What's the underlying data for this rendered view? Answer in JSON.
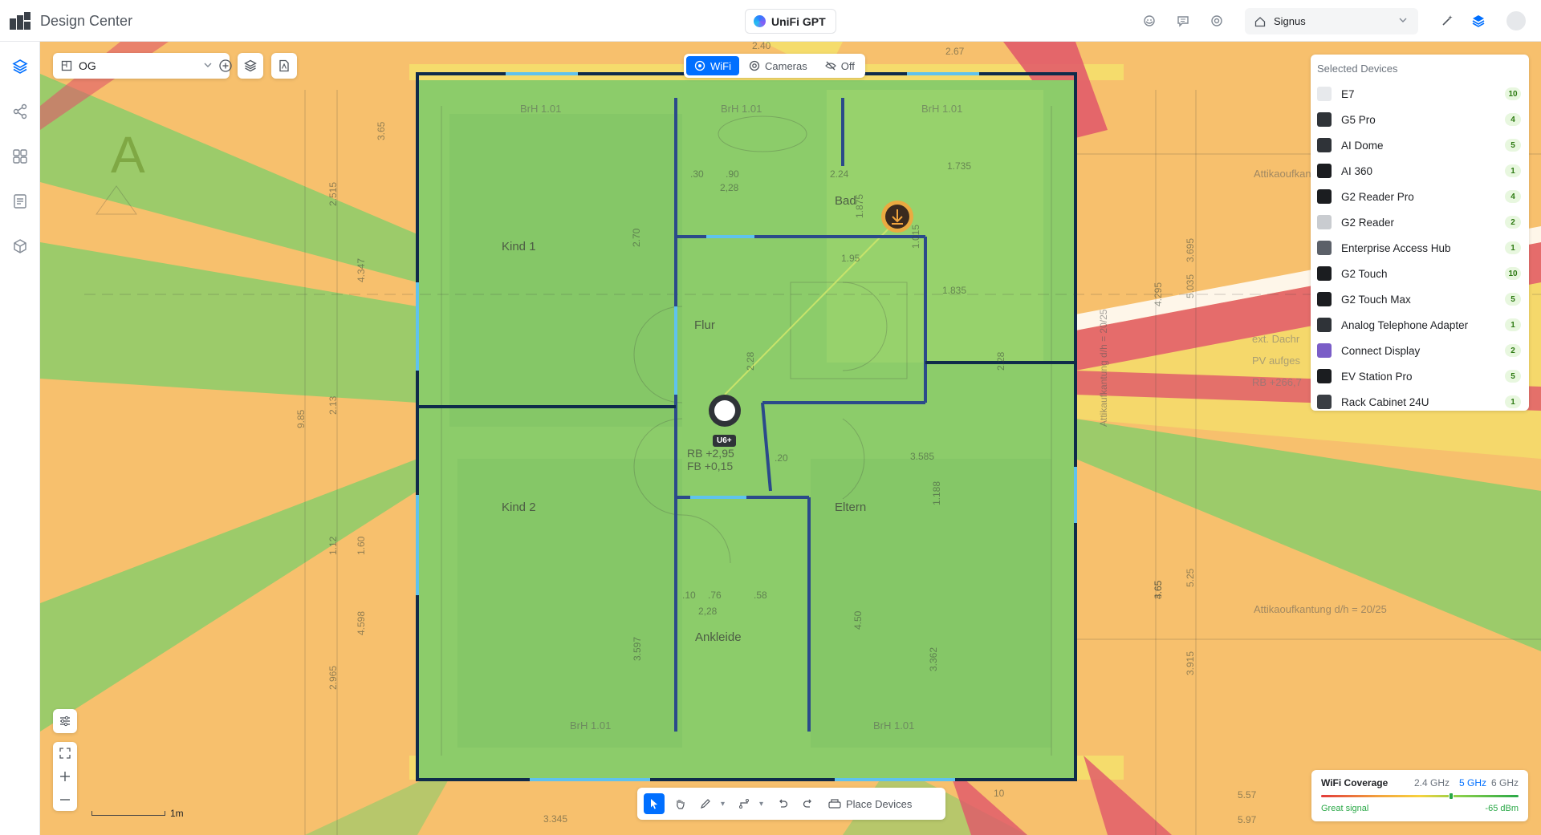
{
  "header": {
    "app_title": "Design Center",
    "gpt_label": "UniFi GPT",
    "site_name": "Signus"
  },
  "canvas": {
    "floor": "OG",
    "modes": [
      {
        "label": "WiFi",
        "icon": "wifi-icon",
        "active": true
      },
      {
        "label": "Cameras",
        "icon": "camera-icon",
        "active": false
      },
      {
        "label": "Off",
        "icon": "eye-off-icon",
        "active": false
      }
    ],
    "rooms": [
      "Kind 1",
      "Kind 2",
      "Flur",
      "Bad",
      "Eltern",
      "Ankleide"
    ],
    "ap_label": "U6+",
    "section_letter": "A",
    "scale_label": "1m",
    "plan_text": {
      "brh1": "BrH 1.01",
      "rb": "RB +2,95",
      "fb": "FB +0,15",
      "attika1": "Attikaoufkantung",
      "attika2": "Attikaoufkantung  d/h = 20/25",
      "attika_v": "Attikaufkantung d/h = 20/25",
      "ext": "ext. Dachr",
      "pv": "PV aufges",
      "rb2": "RB +266,7",
      "dims": [
        "2.40",
        "2.67",
        "3.585",
        "5.57",
        "5.97",
        "3.345",
        "1.95",
        "2.24",
        "1.835",
        "2,28",
        "2,28",
        ".90",
        ".30",
        ".76",
        ".58",
        ".10",
        "10",
        ".20",
        "1.735",
        "1.20"
      ],
      "vdims": [
        "2.515",
        "4.347",
        "9.85",
        "2.13",
        "1.12",
        "1.60",
        "4.598",
        "2.965",
        "3.65",
        "3.695",
        "4.295",
        "5.035",
        "4.65",
        "5.25",
        "3.915",
        "3.597",
        "3.362",
        "4.50",
        "2.70",
        "2.28",
        "1.875",
        "1.015",
        "1.188",
        "2.28",
        "3.65"
      ]
    }
  },
  "selected_devices": {
    "title": "Selected Devices",
    "items": [
      {
        "name": "E7",
        "count": "10",
        "thumb": "#e7e9ec"
      },
      {
        "name": "G5 Pro",
        "count": "4",
        "thumb": "#2f3338"
      },
      {
        "name": "AI Dome",
        "count": "5",
        "thumb": "#2f3338"
      },
      {
        "name": "AI 360",
        "count": "1",
        "thumb": "#1b1d20"
      },
      {
        "name": "G2 Reader Pro",
        "count": "4",
        "thumb": "#1b1d20"
      },
      {
        "name": "G2 Reader",
        "count": "2",
        "thumb": "#c9ccd0"
      },
      {
        "name": "Enterprise Access Hub",
        "count": "1",
        "thumb": "#5b6068"
      },
      {
        "name": "G2 Touch",
        "count": "10",
        "thumb": "#1b1d20"
      },
      {
        "name": "G2 Touch Max",
        "count": "5",
        "thumb": "#1b1d20"
      },
      {
        "name": "Analog Telephone Adapter",
        "count": "1",
        "thumb": "#2f3338"
      },
      {
        "name": "Connect Display",
        "count": "2",
        "thumb": "#7a5dc7"
      },
      {
        "name": "EV Station Pro",
        "count": "5",
        "thumb": "#1b1d20"
      },
      {
        "name": "Rack Cabinet 24U",
        "count": "1",
        "thumb": "#3a3e44"
      }
    ]
  },
  "toolbar": {
    "place_devices": "Place Devices"
  },
  "coverage": {
    "title": "WiFi Coverage",
    "bands": [
      "2.4 GHz",
      "5 GHz",
      "6 GHz"
    ],
    "active_band": "5 GHz",
    "signal_text": "Great signal",
    "dbm": "-65 dBm",
    "signal_level": 0.66,
    "colors": {
      "accent": "#006fff",
      "good": "#2aa847",
      "coverage_green": "#8ccc6a",
      "poor": "#e23a3a",
      "mid": "#f7c06d"
    }
  }
}
